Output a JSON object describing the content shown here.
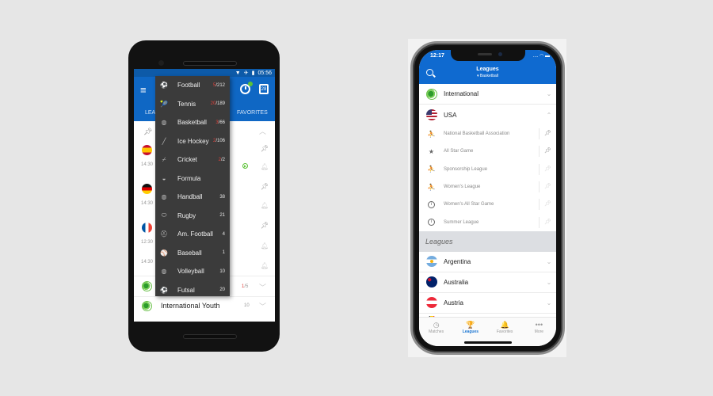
{
  "android": {
    "status_time": "05:56",
    "tabs": [
      "LEA",
      "FAVORITES"
    ],
    "calendar_day": "28",
    "sports_menu": [
      {
        "icon": "football-icon",
        "glyph": "⚽",
        "label": "Football",
        "live": "5",
        "total": "/212"
      },
      {
        "icon": "tennis-icon",
        "glyph": "🎾",
        "label": "Tennis",
        "live": "20",
        "total": "/189"
      },
      {
        "icon": "basketball-icon",
        "glyph": "◍",
        "label": "Basketball",
        "live": "3",
        "total": "/66"
      },
      {
        "icon": "ice-hockey-icon",
        "glyph": "╱",
        "label": "Ice Hockey",
        "live": "2",
        "total": "/106"
      },
      {
        "icon": "cricket-icon",
        "glyph": "⌿",
        "label": "Cricket",
        "live": "2",
        "total": "/2"
      },
      {
        "icon": "formula-icon",
        "glyph": "◒",
        "label": "Formula",
        "live": "",
        "total": ""
      },
      {
        "icon": "handball-icon",
        "glyph": "◍",
        "label": "Handball",
        "live": "",
        "total": "38"
      },
      {
        "icon": "rugby-icon",
        "glyph": "⬭",
        "label": "Rugby",
        "live": "",
        "total": "21"
      },
      {
        "icon": "am-football-icon",
        "glyph": "⛑",
        "label": "Am. Football",
        "live": "",
        "total": "4"
      },
      {
        "icon": "baseball-icon",
        "glyph": "⚾",
        "label": "Baseball",
        "live": "",
        "total": "1"
      },
      {
        "icon": "volleyball-icon",
        "glyph": "◍",
        "label": "Volleyball",
        "live": "",
        "total": "10"
      },
      {
        "icon": "futsal-icon",
        "glyph": "⚽",
        "label": "Futsal",
        "live": "",
        "total": "20"
      }
    ],
    "match_times": [
      "14:30",
      "14:30",
      "12:30",
      "14:30"
    ],
    "international_count": {
      "live": "1",
      "total": "/5"
    },
    "international_youth": {
      "label": "International Youth",
      "count": "10"
    }
  },
  "iphone": {
    "status_time": "12:17",
    "title": "Leagues",
    "subtitle": "▾ Basketball",
    "top_rows": [
      {
        "icon": "globe-icon",
        "label": "International",
        "chevron": "⌄"
      },
      {
        "icon": "usa-flag-icon",
        "label": "USA",
        "chevron": "⌃"
      }
    ],
    "usa_leagues": [
      {
        "icon": "nba-logo-icon",
        "glyph": "⛹",
        "label": "National Basketball Association",
        "pinned": true
      },
      {
        "icon": "all-star-logo-icon",
        "glyph": "★",
        "label": "All Star Game",
        "pinned": true
      },
      {
        "icon": "player-icon",
        "glyph": "⛹",
        "label": "Sponsorship League",
        "pinned": false
      },
      {
        "icon": "player-icon",
        "glyph": "⛹",
        "label": "Women's League",
        "pinned": false
      },
      {
        "icon": "info-icon",
        "glyph": "i",
        "label": "Women's All Star Game",
        "pinned": false
      },
      {
        "icon": "info-icon",
        "glyph": "i",
        "label": "Summer League",
        "pinned": false
      }
    ],
    "section_header": "Leagues",
    "countries": [
      "Argentina",
      "Australia",
      "Austria"
    ],
    "tabbar": [
      {
        "icon": "clock-icon",
        "glyph": "◷",
        "label": "Matches",
        "active": false
      },
      {
        "icon": "trophy-icon",
        "glyph": "🏆",
        "label": "Leagues",
        "active": true
      },
      {
        "icon": "bell-icon",
        "glyph": "🔔",
        "label": "Favorites",
        "active": false
      },
      {
        "icon": "more-icon",
        "glyph": "•••",
        "label": "More",
        "active": false
      }
    ]
  }
}
